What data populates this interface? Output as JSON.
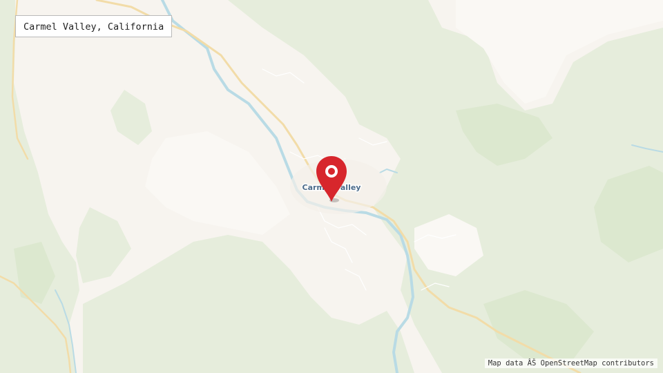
{
  "map": {
    "title": "Carmel Valley, California",
    "place_label": "Carmel Valley",
    "attribution": "Map data ÂŠ OpenStreetMap contributors",
    "marker_icon": "map-pin-icon",
    "colors": {
      "background": "#f7f4ef",
      "forest": "#e6eddc",
      "forest_dark": "#dce8cf",
      "river": "#b9dbe5",
      "road_major": "#f2dca8",
      "road_minor": "#ffffff",
      "marker": "#d7262c",
      "label": "#4b6b8a"
    }
  }
}
